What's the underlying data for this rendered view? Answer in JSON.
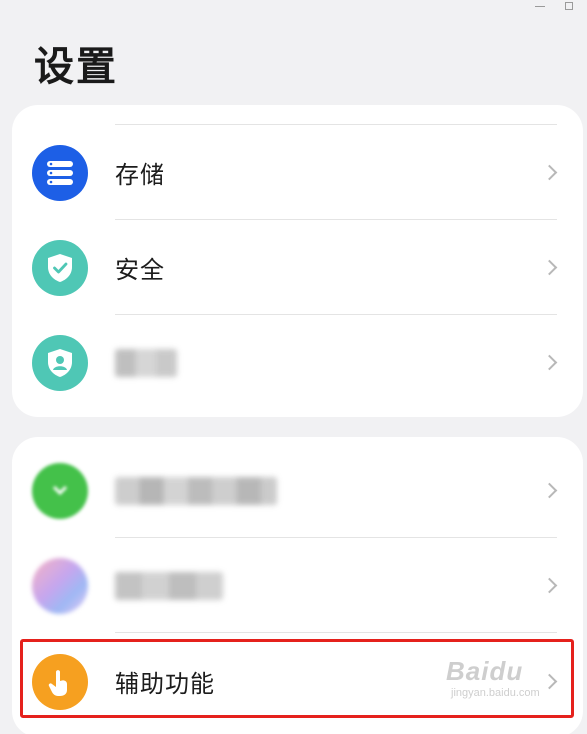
{
  "page": {
    "title": "设置"
  },
  "groups": [
    {
      "items": [
        {
          "label": "存储",
          "icon": "storage-icon",
          "icon_color": "#1d5fe6"
        },
        {
          "label": "安全",
          "icon": "shield-check-icon",
          "icon_color": "#4fc7b5"
        },
        {
          "label": "",
          "icon": "privacy-shield-icon",
          "icon_color": "#4fc7b5",
          "blurred": true
        }
      ]
    },
    {
      "items": [
        {
          "label": "",
          "icon": "blurred-app-icon",
          "icon_color": "#44c14a",
          "blurred": true
        },
        {
          "label": "",
          "icon": "blurred-app-icon",
          "icon_color": "#c9a7ec",
          "blurred": true
        },
        {
          "label": "辅助功能",
          "icon": "accessibility-hand-icon",
          "icon_color": "#f6a020",
          "highlighted": true
        }
      ]
    }
  ],
  "watermark": {
    "brand": "Baidu",
    "sub": "jingyan.baidu.com"
  },
  "colors": {
    "highlight": "#e5211c",
    "background": "#f1f1f3"
  }
}
